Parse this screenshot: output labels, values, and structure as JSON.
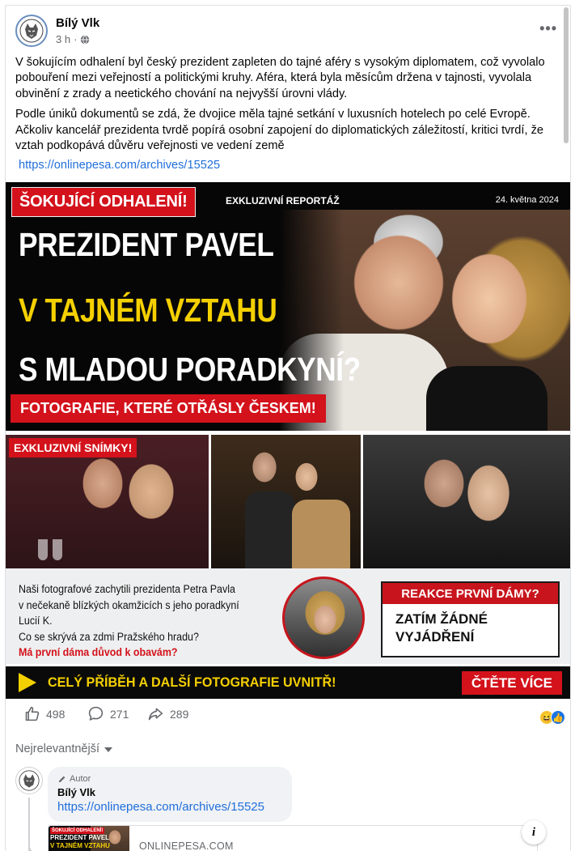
{
  "post": {
    "author": "Bílý Vlk",
    "time": "3 h",
    "separator": "·",
    "more_label": "•••",
    "paragraph1": "V šokujícím odhalení byl český prezident zapleten do tajné aféry s vysokým diplomatem, což vyvolalo pobouření mezi veřejností a politickými kruhy. Aféra, která byla měsícům držena v tajnosti, vyvolala obvinění z zrady a neetického chování na nejvyšší úrovni vlády.",
    "paragraph2": "Podle úniků dokumentů se zdá, že dvojice měla tajné setkání v luxusních hotelech po celé Evropě. Ačkoliv kancelář prezidenta tvrdě popírá osobní zapojení do diplomatických záležitostí, kritici tvrdí, že vztah podkopává důvěru veřejnosti ve vedení země",
    "link": "https://onlinepesa.com/archives/15525"
  },
  "banner": {
    "tag_top": "ŠOKUJÍCÍ ODHALENÍ!",
    "section": "EXKLUZIVNÍ REPORTÁŽ",
    "date": "24. května 2024",
    "headline1": "PREZIDENT PAVEL",
    "headline2": "V TAJNÉM VZTAHU",
    "headline3": "S MLADOU PORADKYNÍ?",
    "subtag": "FOTOGRAFIE, KTERÉ OTŘÁSLY ČESKEM!",
    "photos_tag": "EXKLUZIVNÍ SNÍMKY!",
    "info_line1": "Naši fotografové zachytili prezidenta Petra Pavla",
    "info_line2": "v nečekaně blízkých okamžicích s jeho poradkyní Lucií K.",
    "info_line3": "Co se skrývá za zdmi Pražského hradu?",
    "info_question": "Má první dáma důvod k obavám?",
    "reaction_head": "REAKCE PRVNÍ DÁMY?",
    "reaction_line1": "ZATÍM ŽÁDNÉ",
    "reaction_line2": "VYJÁDŘENÍ",
    "cta_text": "CELÝ PŘÍBĚH A DALŠÍ FOTOGRAFIE UVNITŘ!",
    "cta_button": "ČTĚTE VÍCE",
    "accent_red": "#d3121b",
    "accent_yellow": "#f5d000"
  },
  "stats": {
    "likes": "498",
    "comments": "271",
    "shares": "289"
  },
  "comments": {
    "sort_label": "Nejrelevantnější",
    "items": [
      {
        "badge": "Autor",
        "name": "Bílý Vlk",
        "link": "https://onlinepesa.com/archives/15525",
        "preview_domain": "ONLINEPESA.COM",
        "preview_tag": "ŠOKUJÍCÍ ODHALENÍ!",
        "preview_line1": "PREZIDENT PAVEL",
        "preview_line2": "V TAJNÉM VZTAHU"
      }
    ]
  },
  "icons": {
    "like": "thumbs-up-icon",
    "comment": "comment-bubble-icon",
    "share": "share-arrow-icon",
    "privacy": "globe-icon",
    "info": "info-icon"
  }
}
